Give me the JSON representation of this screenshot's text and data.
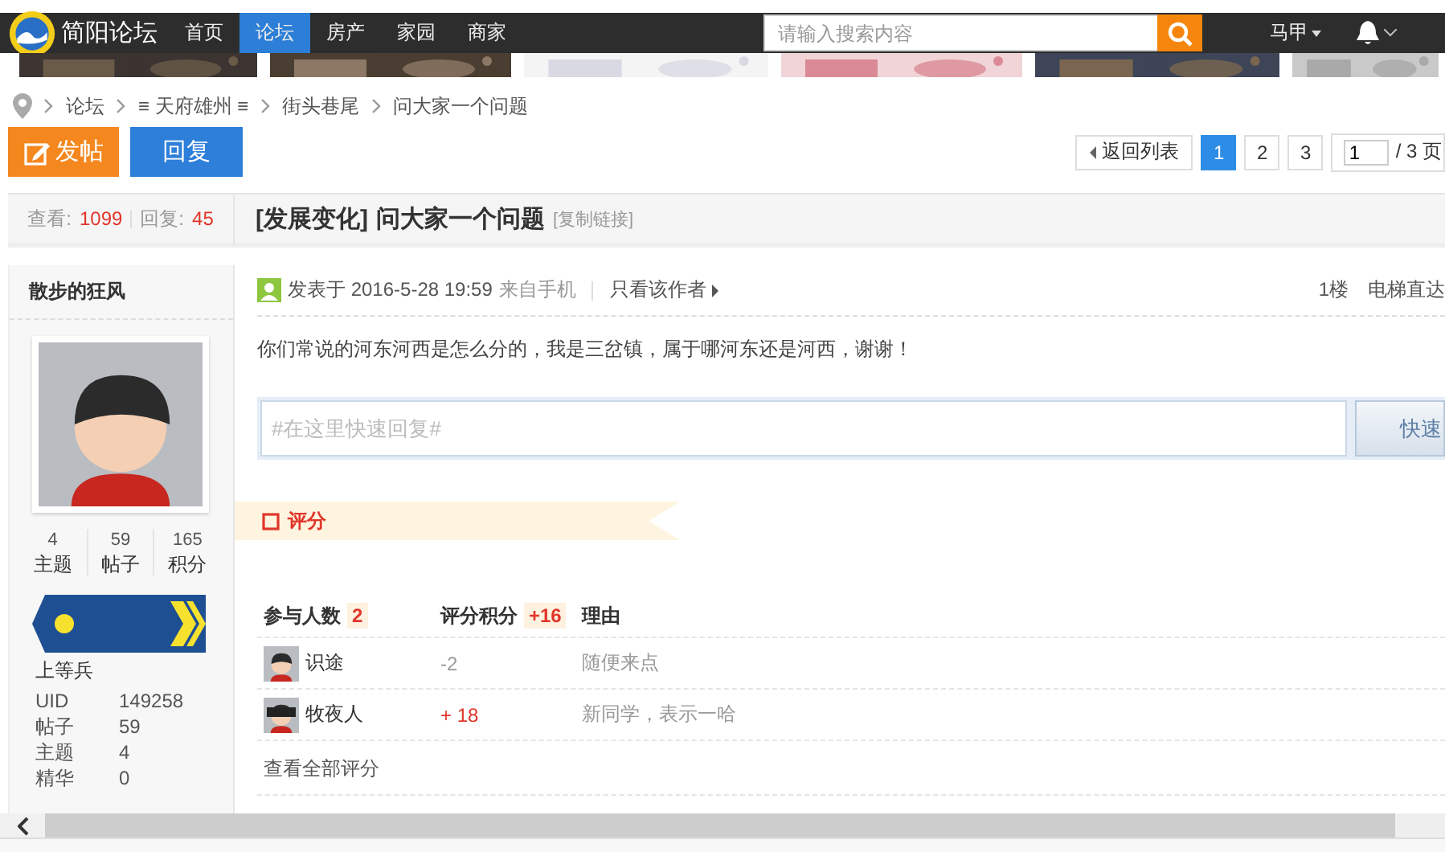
{
  "nav": {
    "logo_text": "简阳论坛",
    "items": [
      {
        "label": "首页",
        "selected": false
      },
      {
        "label": "论坛",
        "selected": true
      },
      {
        "label": "房产",
        "selected": false
      },
      {
        "label": "家园",
        "selected": false
      },
      {
        "label": "商家",
        "selected": false
      }
    ],
    "search": {
      "placeholder": "请输入搜索内容"
    },
    "user": "马甲"
  },
  "breadcrumb": [
    "论坛",
    "≡ 天府雄州 ≡",
    "街头巷尾",
    "问大家一个问题"
  ],
  "actions": {
    "new_post": "发帖",
    "reply": "回复"
  },
  "pagination": {
    "back": "返回列表",
    "pages": [
      {
        "label": "1",
        "selected": true
      },
      {
        "label": "2",
        "selected": false
      },
      {
        "label": "3",
        "selected": false
      }
    ],
    "page_input": "1",
    "total": "/ 3 页"
  },
  "stats": {
    "views_label": "查看:",
    "views": "1099",
    "replies_label": "回复:",
    "replies": "45"
  },
  "thread": {
    "category": "[发展变化]",
    "title": "问大家一个问题",
    "copy_link": "[复制链接]"
  },
  "author": {
    "name": "散步的狂风",
    "counts": [
      {
        "value": "4",
        "label": "主题"
      },
      {
        "value": "59",
        "label": "帖子"
      },
      {
        "value": "165",
        "label": "积分"
      }
    ],
    "rank": "上等兵",
    "info": [
      {
        "label": "UID",
        "value": "149258"
      },
      {
        "label": "帖子",
        "value": "59"
      },
      {
        "label": "主题",
        "value": "4"
      },
      {
        "label": "精华",
        "value": "0"
      }
    ]
  },
  "post": {
    "posted": "发表于 2016-5-28 19:59",
    "source": "来自手机",
    "only_author": "只看该作者",
    "floor": "1楼",
    "jump": "电梯直达",
    "body": "你们常说的河东河西是怎么分的，我是三岔镇，属于哪河东还是河西，谢谢！"
  },
  "quick_reply": {
    "placeholder": "#在这里快速回复#",
    "button": "快速"
  },
  "rating": {
    "title": "评分",
    "participants_label": "参与人数",
    "participants": "2",
    "score_label": "评分积分",
    "score": "+16",
    "reason_label": "理由",
    "rows": [
      {
        "user": "识途",
        "score": "-2",
        "positive": false,
        "reason": "随便来点"
      },
      {
        "user": "牧夜人",
        "score": "+ 18",
        "positive": true,
        "reason": "新同学，表示一哈"
      }
    ],
    "view_all": "查看全部评分"
  }
}
